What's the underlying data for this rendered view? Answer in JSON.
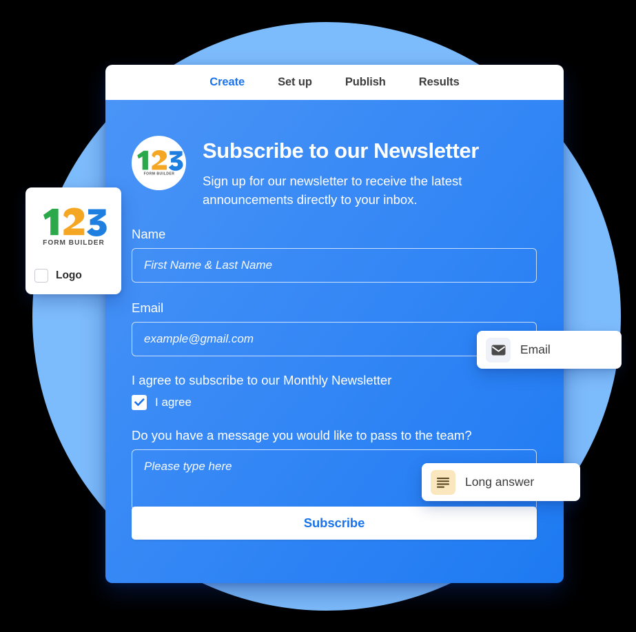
{
  "tabs": [
    {
      "label": "Create",
      "active": true
    },
    {
      "label": "Set up",
      "active": false
    },
    {
      "label": "Publish",
      "active": false
    },
    {
      "label": "Results",
      "active": false
    }
  ],
  "form": {
    "title": "Subscribe to our Newsletter",
    "subtitle": "Sign up for our newsletter to receive the latest announcements directly to your inbox.",
    "logo_wordmark": "FORM BUILDER",
    "fields": {
      "name": {
        "label": "Name",
        "placeholder": "First Name & Last Name",
        "value": ""
      },
      "email": {
        "label": "Email",
        "placeholder": "example@gmail.com",
        "value": ""
      },
      "agree": {
        "question": "I agree to subscribe to our Monthly Newsletter",
        "option_label": "I agree",
        "checked": true
      },
      "message": {
        "label": "Do you have a message you would like to pass to the team?",
        "placeholder": "Please type here",
        "value": ""
      }
    },
    "submit_label": "Subscribe"
  },
  "logo_panel": {
    "wordmark": "FORM BUILDER",
    "checkbox_label": "Logo",
    "checked": false
  },
  "badges": [
    {
      "label": "Email",
      "icon": "envelope-icon"
    },
    {
      "label": "Long answer",
      "icon": "long-answer-icon"
    }
  ],
  "colors": {
    "accent_blue": "#1a73ec",
    "card_blue_light": "#4a94f7",
    "card_blue_dark": "#1e7af2",
    "background_circle": "#7dbcfc",
    "logo_green": "#2ba84a",
    "logo_orange": "#f5a623",
    "logo_blue": "#1f7fe0",
    "badge_long_icon_bg": "#fae7bd",
    "badge_email_icon_bg": "#eef1f7"
  }
}
